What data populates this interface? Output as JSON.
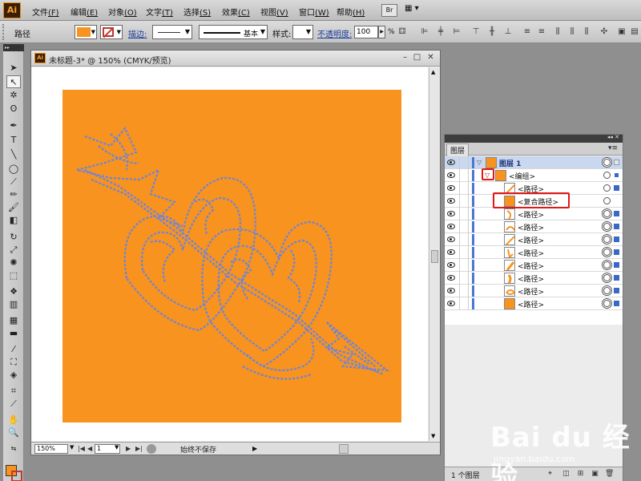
{
  "app": {
    "logo": "Ai",
    "menu": [
      {
        "label": "文件",
        "key": "(F)"
      },
      {
        "label": "编辑",
        "key": "(E)"
      },
      {
        "label": "对象",
        "key": "(O)"
      },
      {
        "label": "文字",
        "key": "(T)"
      },
      {
        "label": "选择",
        "key": "(S)"
      },
      {
        "label": "效果",
        "key": "(C)"
      },
      {
        "label": "视图",
        "key": "(V)"
      },
      {
        "label": "窗口",
        "key": "(W)"
      },
      {
        "label": "帮助",
        "key": "(H)"
      }
    ],
    "bridge_label": "Br"
  },
  "control": {
    "path_label": "路径",
    "fill_color": "#f7931e",
    "stroke_color": "#c0392b",
    "stroke_label": "描边:",
    "brush_label": "基本",
    "style_label": "样式:",
    "opacity_label": "不透明度:",
    "opacity_value": "100",
    "opacity_unit": "%"
  },
  "document": {
    "title": "未标题-3* @ 150% (CMYK/预览)",
    "artboard_color": "#f7931e",
    "path_color": "#6a84e0",
    "zoom": "150%",
    "page": "1",
    "status": "始终不保存"
  },
  "layers": {
    "tab": "图层",
    "footer": "1 个图层",
    "rows": [
      {
        "label": "图层 1"
      },
      {
        "label": "<编组>"
      },
      {
        "label": "<路径>"
      },
      {
        "label": "<复合路径>"
      },
      {
        "label": "<路径>"
      },
      {
        "label": "<路径>"
      },
      {
        "label": "<路径>"
      },
      {
        "label": "<路径>"
      },
      {
        "label": "<路径>"
      },
      {
        "label": "<路径>"
      },
      {
        "label": "<路径>"
      },
      {
        "label": "<路径>"
      }
    ]
  },
  "watermark": {
    "brand": "Bai du 经验",
    "url": "jingyan.baidu.com"
  }
}
